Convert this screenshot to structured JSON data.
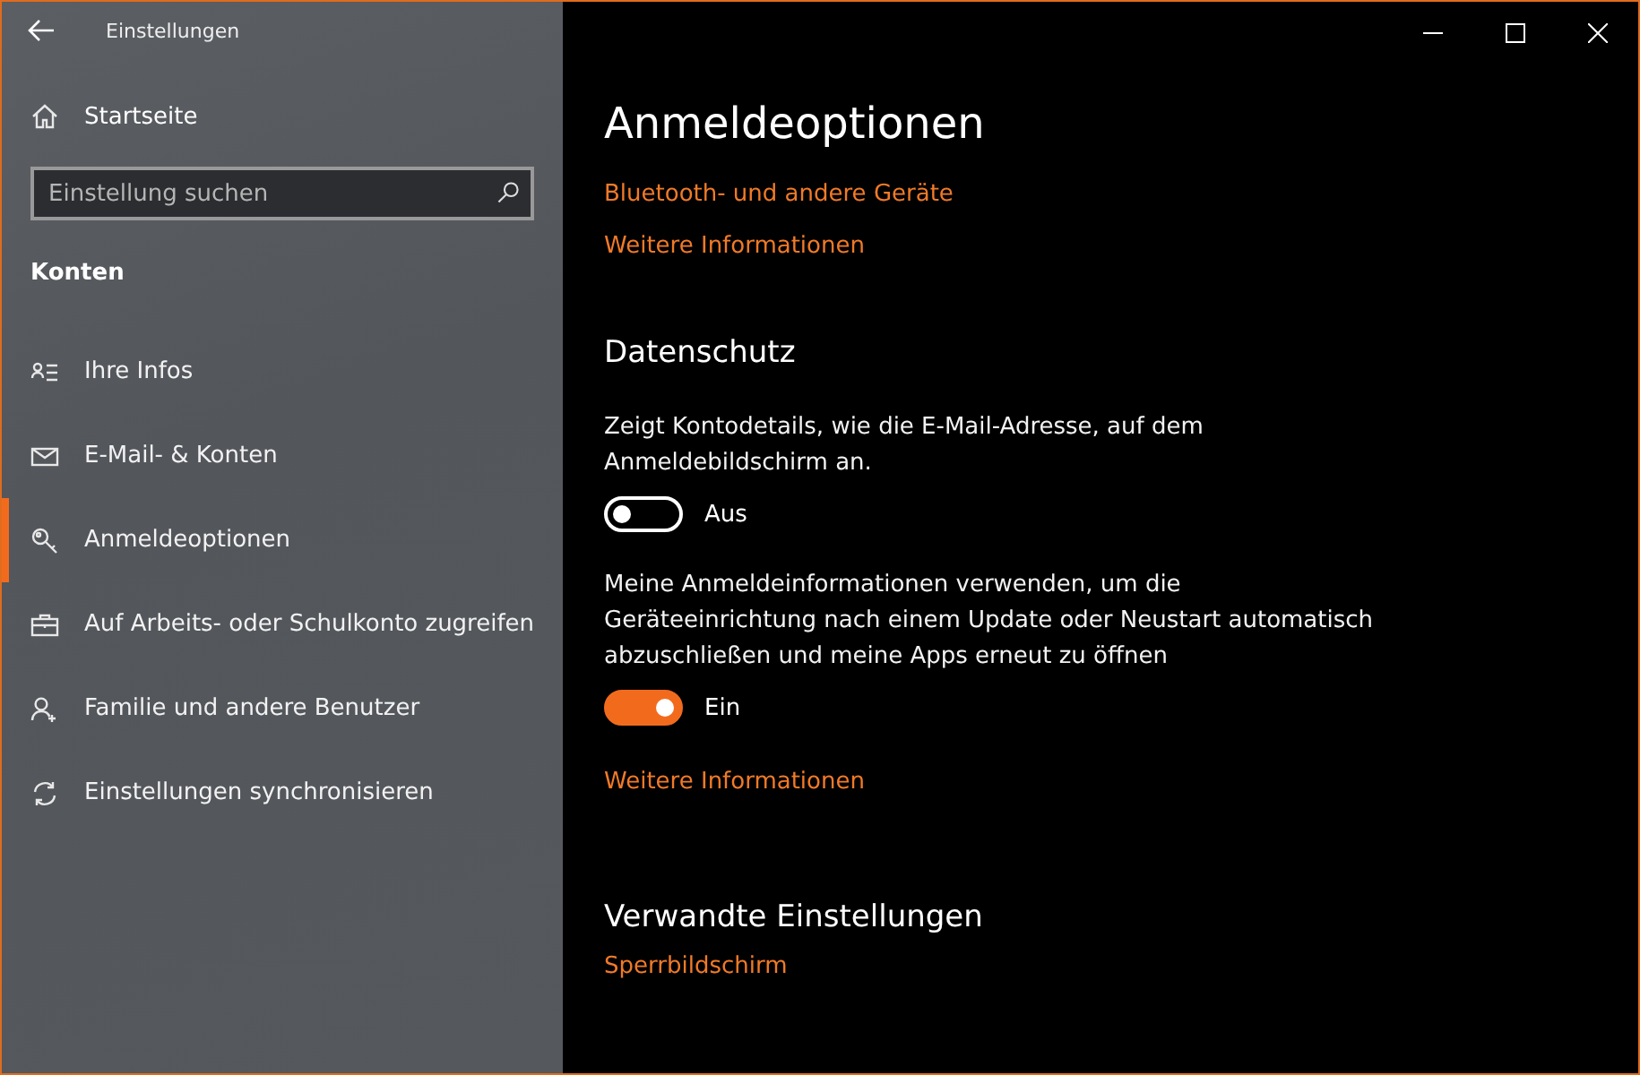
{
  "window": {
    "title": "Einstellungen"
  },
  "sidebar": {
    "home": "Startseite",
    "search": {
      "placeholder": "Einstellung suchen"
    },
    "section": "Konten",
    "items": [
      {
        "label": "Ihre Infos",
        "selected": false
      },
      {
        "label": "E-Mail- & Konten",
        "selected": false
      },
      {
        "label": "Anmeldeoptionen",
        "selected": true
      },
      {
        "label": "Auf Arbeits- oder Schulkonto zugreifen",
        "selected": false
      },
      {
        "label": "Familie und andere Benutzer",
        "selected": false
      },
      {
        "label": "Einstellungen synchronisieren",
        "selected": false
      }
    ]
  },
  "content": {
    "title": "Anmeldeoptionen",
    "top_links": [
      "Bluetooth- und andere Geräte",
      "Weitere Informationen"
    ],
    "privacy": {
      "heading": "Datenschutz",
      "settings": [
        {
          "description": "Zeigt Kontodetails, wie die E-Mail-Adresse, auf dem Anmeldebildschirm an.",
          "on": false,
          "state_label": "Aus"
        },
        {
          "description": "Meine Anmeldeinformationen verwenden, um die Geräteeinrichtung nach einem Update oder Neustart automatisch abzuschließen und meine Apps erneut zu öffnen",
          "on": true,
          "state_label": "Ein"
        }
      ],
      "link": "Weitere Informationen"
    },
    "related": {
      "heading": "Verwandte Einstellungen",
      "links": [
        "Sperrbildschirm"
      ]
    }
  }
}
